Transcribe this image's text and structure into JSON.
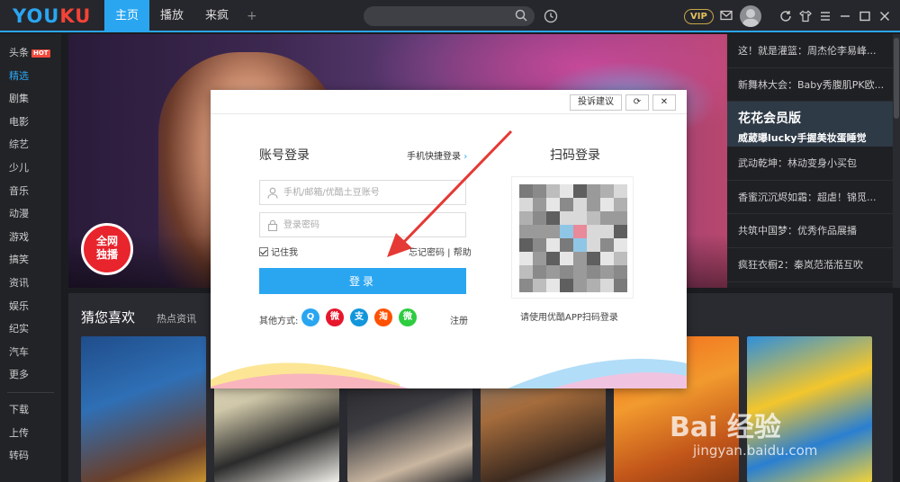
{
  "app": {
    "logo_left": "YOU",
    "logo_right": "KU",
    "vip": "VIP"
  },
  "nav": {
    "items": [
      "主页",
      "播放",
      "来疯"
    ],
    "active": 0,
    "plus": "+"
  },
  "sidebar": {
    "hot": "HOT",
    "items": [
      "头条",
      "精选",
      "剧集",
      "电影",
      "综艺",
      "少儿",
      "音乐",
      "动漫",
      "游戏",
      "搞笑",
      "资讯",
      "娱乐",
      "纪实",
      "汽车",
      "更多"
    ],
    "bottom": [
      "下载",
      "上传",
      "转码"
    ]
  },
  "banner": {
    "badge_line1": "全网",
    "badge_line2": "独播"
  },
  "right_list": {
    "top": [
      "这！就是灌篮：周杰伦李易峰...",
      "新舞林大会：Baby秀腹肌PK欧..."
    ],
    "feature_title": "花花会员版",
    "feature_sub": "威葳曝lucky手握美妆蛋睡觉",
    "bottom": [
      "武动乾坤：林动变身小买包",
      "香蜜沉沉烬如霜：超虐！锦觅...",
      "共筑中国梦：优秀作品展播",
      "疯狂衣橱2：秦岚范湉湉互吹"
    ]
  },
  "guess": {
    "title": "猜您喜欢",
    "tab": "热点资讯"
  },
  "modal": {
    "feedback": "投诉建议",
    "refresh": "⟳",
    "close": "✕",
    "login_title": "账号登录",
    "quick_login": "手机快捷登录",
    "account_placeholder": "手机/邮箱/优酷土豆账号",
    "password_placeholder": "登录密码",
    "remember": "记住我",
    "forgot": "忘记密码",
    "help": "帮助",
    "login_button": "登录",
    "other_methods": "其他方式:",
    "socials": [
      {
        "name": "qq",
        "glyph": "Q",
        "color": "#2aa6f1"
      },
      {
        "name": "weibo",
        "glyph": "微",
        "color": "#e6162d"
      },
      {
        "name": "alipay",
        "glyph": "支",
        "color": "#1296db"
      },
      {
        "name": "taobao",
        "glyph": "淘",
        "color": "#ff5000"
      },
      {
        "name": "wechat",
        "glyph": "微",
        "color": "#2ecc40"
      }
    ],
    "register": "注册",
    "qr_title": "扫码登录",
    "qr_hint": "请使用优酷APP扫码登录"
  },
  "watermark": {
    "main": "Bai 经验",
    "sub": "jingyan.baidu.com"
  },
  "colors": {
    "accent": "#2aa6f1",
    "topbar": "#26272c",
    "arrow": "#e53935"
  }
}
